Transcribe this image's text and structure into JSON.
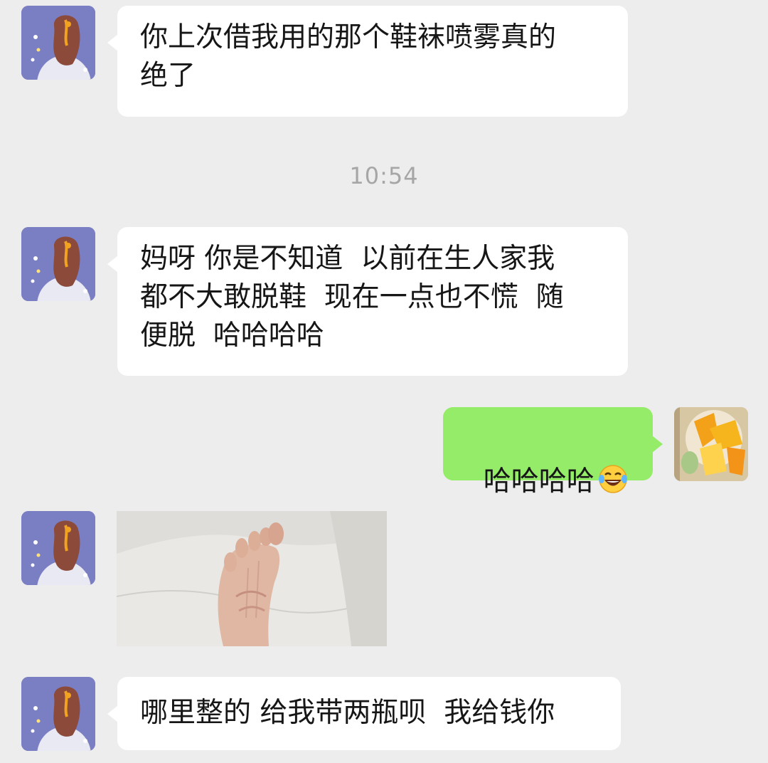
{
  "messages": [
    {
      "side": "left",
      "text": "你上次借我用的那个鞋袜喷雾真的\n绝了"
    },
    {
      "side": "left",
      "text": "妈呀 你是不知道  以前在生人家我\n都不大敢脱鞋  现在一点也不慌  随\n便脱  哈哈哈哈"
    },
    {
      "side": "right",
      "text": "哈哈哈哈",
      "emoji": "laughing-tears-emoji"
    },
    {
      "side": "left",
      "type": "image"
    },
    {
      "side": "left",
      "text": "哪里整的 给我带两瓶呗  我给钱你"
    }
  ],
  "timestamp": "10:54",
  "colors": {
    "background": "#ededed",
    "incoming_bubble": "#ffffff",
    "outgoing_bubble": "#95ec69",
    "timestamp_text": "#a6a6a6"
  }
}
